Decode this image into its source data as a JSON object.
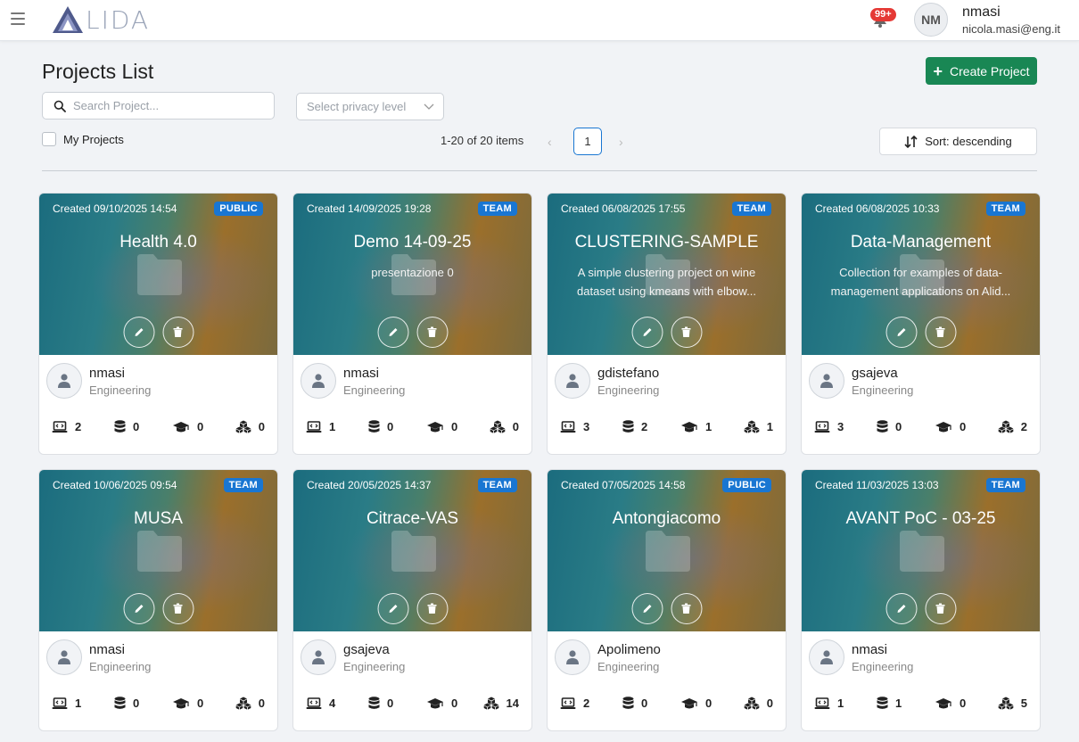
{
  "header": {
    "logo_text": "LIDA",
    "notification_count": "99+",
    "avatar_initials": "NM",
    "user_name": "nmasi",
    "user_email": "nicola.masi@eng.it"
  },
  "page": {
    "title": "Projects List",
    "create_label": "Create Project",
    "search_placeholder": "Search Project...",
    "privacy_placeholder": "Select privacy level",
    "my_projects_label": "My Projects",
    "pagination_info": "1-20 of 20 items",
    "current_page": "1",
    "sort_label": "Sort: descending"
  },
  "colors": {
    "accent": "#198754",
    "badge": "#1976d2"
  },
  "cards": [
    {
      "created": "Created 09/10/2025 14:54",
      "badge": "PUBLIC",
      "title": "Health 4.0",
      "desc1": "",
      "desc2": "",
      "owner": "nmasi",
      "dept": "Engineering",
      "stats": [
        "2",
        "0",
        "0",
        "0"
      ]
    },
    {
      "created": "Created 14/09/2025 19:28",
      "badge": "TEAM",
      "title": "Demo 14-09-25",
      "desc1": "presentazione 0",
      "desc2": "",
      "owner": "nmasi",
      "dept": "Engineering",
      "stats": [
        "1",
        "0",
        "0",
        "0"
      ]
    },
    {
      "created": "Created 06/08/2025 17:55",
      "badge": "TEAM",
      "title": "CLUSTERING-SAMPLE",
      "desc1": "A simple clustering project on wine",
      "desc2": "dataset using kmeans with elbow...",
      "owner": "gdistefano",
      "dept": "Engineering",
      "stats": [
        "3",
        "2",
        "1",
        "1"
      ]
    },
    {
      "created": "Created 06/08/2025 10:33",
      "badge": "TEAM",
      "title": "Data-Management",
      "desc1": "Collection for examples of data-",
      "desc2": "management applications on Alid...",
      "owner": "gsajeva",
      "dept": "Engineering",
      "stats": [
        "3",
        "0",
        "0",
        "2"
      ]
    },
    {
      "created": "Created 10/06/2025 09:54",
      "badge": "TEAM",
      "title": "MUSA",
      "desc1": "",
      "desc2": "",
      "owner": "nmasi",
      "dept": "Engineering",
      "stats": [
        "1",
        "0",
        "0",
        "0"
      ]
    },
    {
      "created": "Created 20/05/2025 14:37",
      "badge": "TEAM",
      "title": "Citrace-VAS",
      "desc1": "",
      "desc2": "",
      "owner": "gsajeva",
      "dept": "Engineering",
      "stats": [
        "4",
        "0",
        "0",
        "14"
      ]
    },
    {
      "created": "Created 07/05/2025 14:58",
      "badge": "PUBLIC",
      "title": "Antongiacomo",
      "desc1": "",
      "desc2": "",
      "owner": "Apolimeno",
      "dept": "Engineering",
      "stats": [
        "2",
        "0",
        "0",
        "0"
      ]
    },
    {
      "created": "Created 11/03/2025 13:03",
      "badge": "TEAM",
      "title": "AVANT PoC - 03-25",
      "desc1": "",
      "desc2": "",
      "owner": "nmasi",
      "dept": "Engineering",
      "stats": [
        "1",
        "1",
        "0",
        "5"
      ]
    }
  ]
}
